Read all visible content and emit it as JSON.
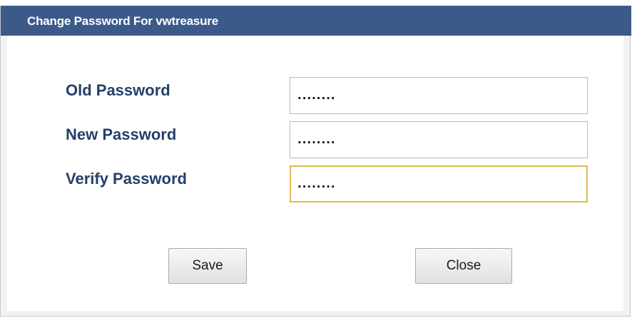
{
  "dialog": {
    "title": "Change Password For vwtreasure"
  },
  "form": {
    "old_password": {
      "label": "Old Password",
      "value": "........"
    },
    "new_password": {
      "label": "New Password",
      "value": "........"
    },
    "verify_password": {
      "label": "Verify Password",
      "value": "........"
    }
  },
  "buttons": {
    "save_label": "Save",
    "close_label": "Close"
  },
  "colors": {
    "titlebar": "#3b5a89",
    "label_text": "#243f6a",
    "focus_border": "#e6b84e"
  }
}
